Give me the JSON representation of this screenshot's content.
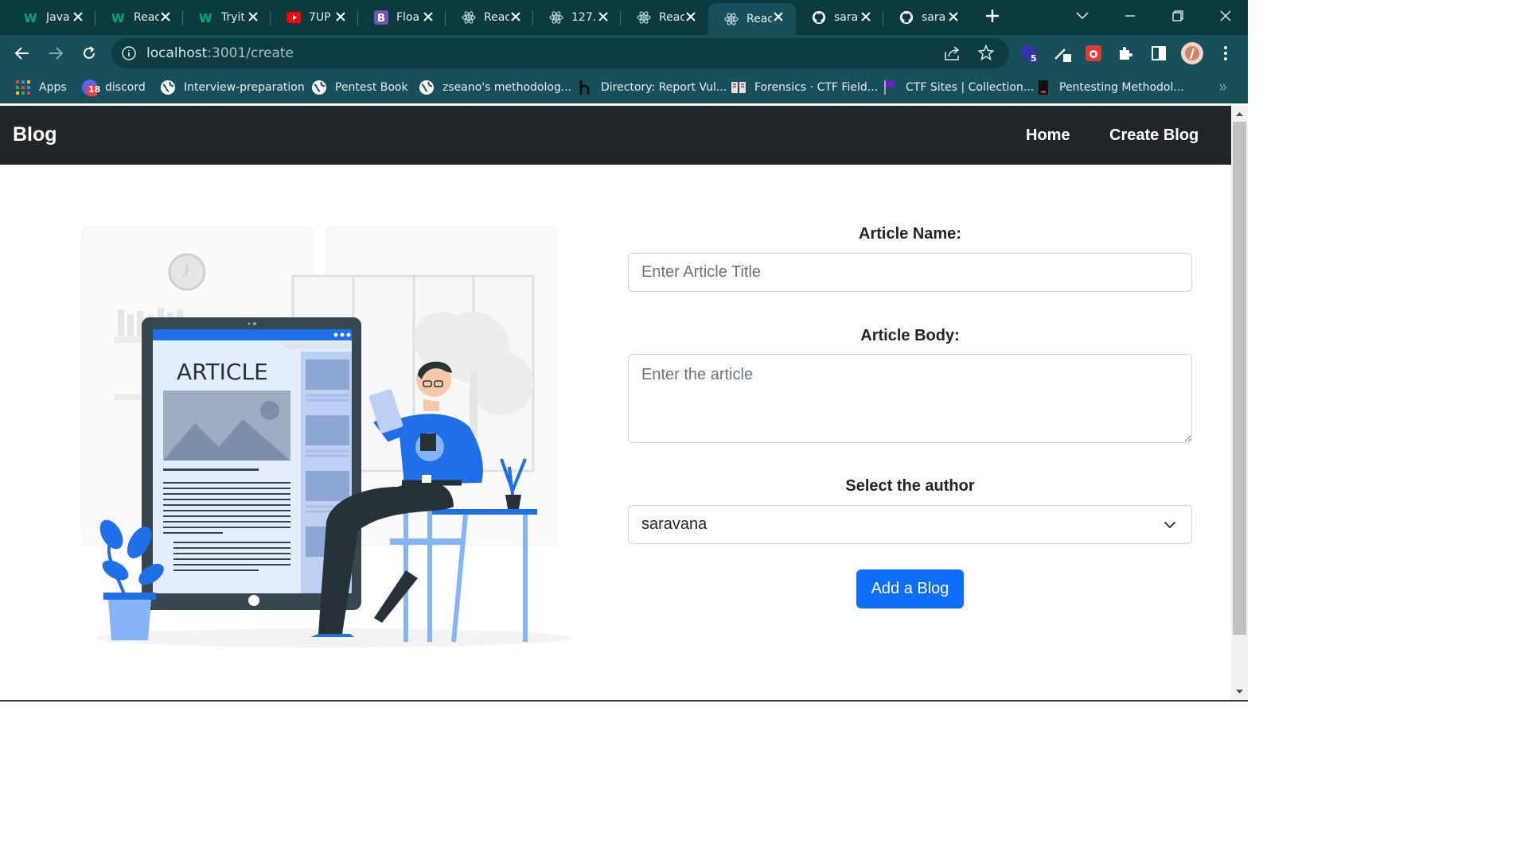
{
  "browser": {
    "tabs": [
      {
        "title": "Java",
        "icon": "w3schools-icon"
      },
      {
        "title": "Reac",
        "icon": "w3schools-icon"
      },
      {
        "title": "Tryit",
        "icon": "w3schools-icon"
      },
      {
        "title": "7UP",
        "icon": "youtube-icon"
      },
      {
        "title": "Floa",
        "icon": "bootstrap-icon"
      },
      {
        "title": "Reac",
        "icon": "react-icon"
      },
      {
        "title": "127.",
        "icon": "react-icon"
      },
      {
        "title": "Reac",
        "icon": "react-icon"
      },
      {
        "title": "Reac",
        "icon": "react-icon",
        "active": true
      },
      {
        "title": "sara",
        "icon": "github-icon"
      },
      {
        "title": "sara",
        "icon": "github-icon"
      }
    ],
    "url_host": "localhost",
    "url_path": ":3001/create",
    "extension_badge": "5",
    "bookmarks": [
      {
        "label": "Apps",
        "icon": "apps-grid-icon"
      },
      {
        "label": "discord",
        "icon": "discord-icon",
        "badge": "18"
      },
      {
        "label": "Interview-preparation",
        "icon": "globe-icon"
      },
      {
        "label": "Pentest Book",
        "icon": "globe-icon"
      },
      {
        "label": "zseano's methodolog...",
        "icon": "globe-icon"
      },
      {
        "label": "Directory: Report Vul...",
        "icon": "hackerone-icon"
      },
      {
        "label": "Forensics · CTF Field...",
        "icon": "book-icon"
      },
      {
        "label": "CTF Sites | Collection...",
        "icon": "flag-icon"
      },
      {
        "label": "Pentesting Methodol...",
        "icon": "doc-icon"
      }
    ]
  },
  "navbar": {
    "brand": "Blog",
    "links": [
      "Home",
      "Create Blog"
    ]
  },
  "illustration": {
    "screen_title": "ARTICLE"
  },
  "form": {
    "title_label": "Article Name:",
    "title_placeholder": "Enter Article Title",
    "body_label": "Article Body:",
    "body_placeholder": "Enter the article",
    "author_label": "Select the author",
    "author_selected": "saravana",
    "submit_label": "Add a Blog"
  },
  "colors": {
    "navbar_bg": "#212529",
    "primary": "#0d6efd",
    "chrome_bg": "#0b3a3f",
    "illustration_blue": "#1e6fe8"
  }
}
